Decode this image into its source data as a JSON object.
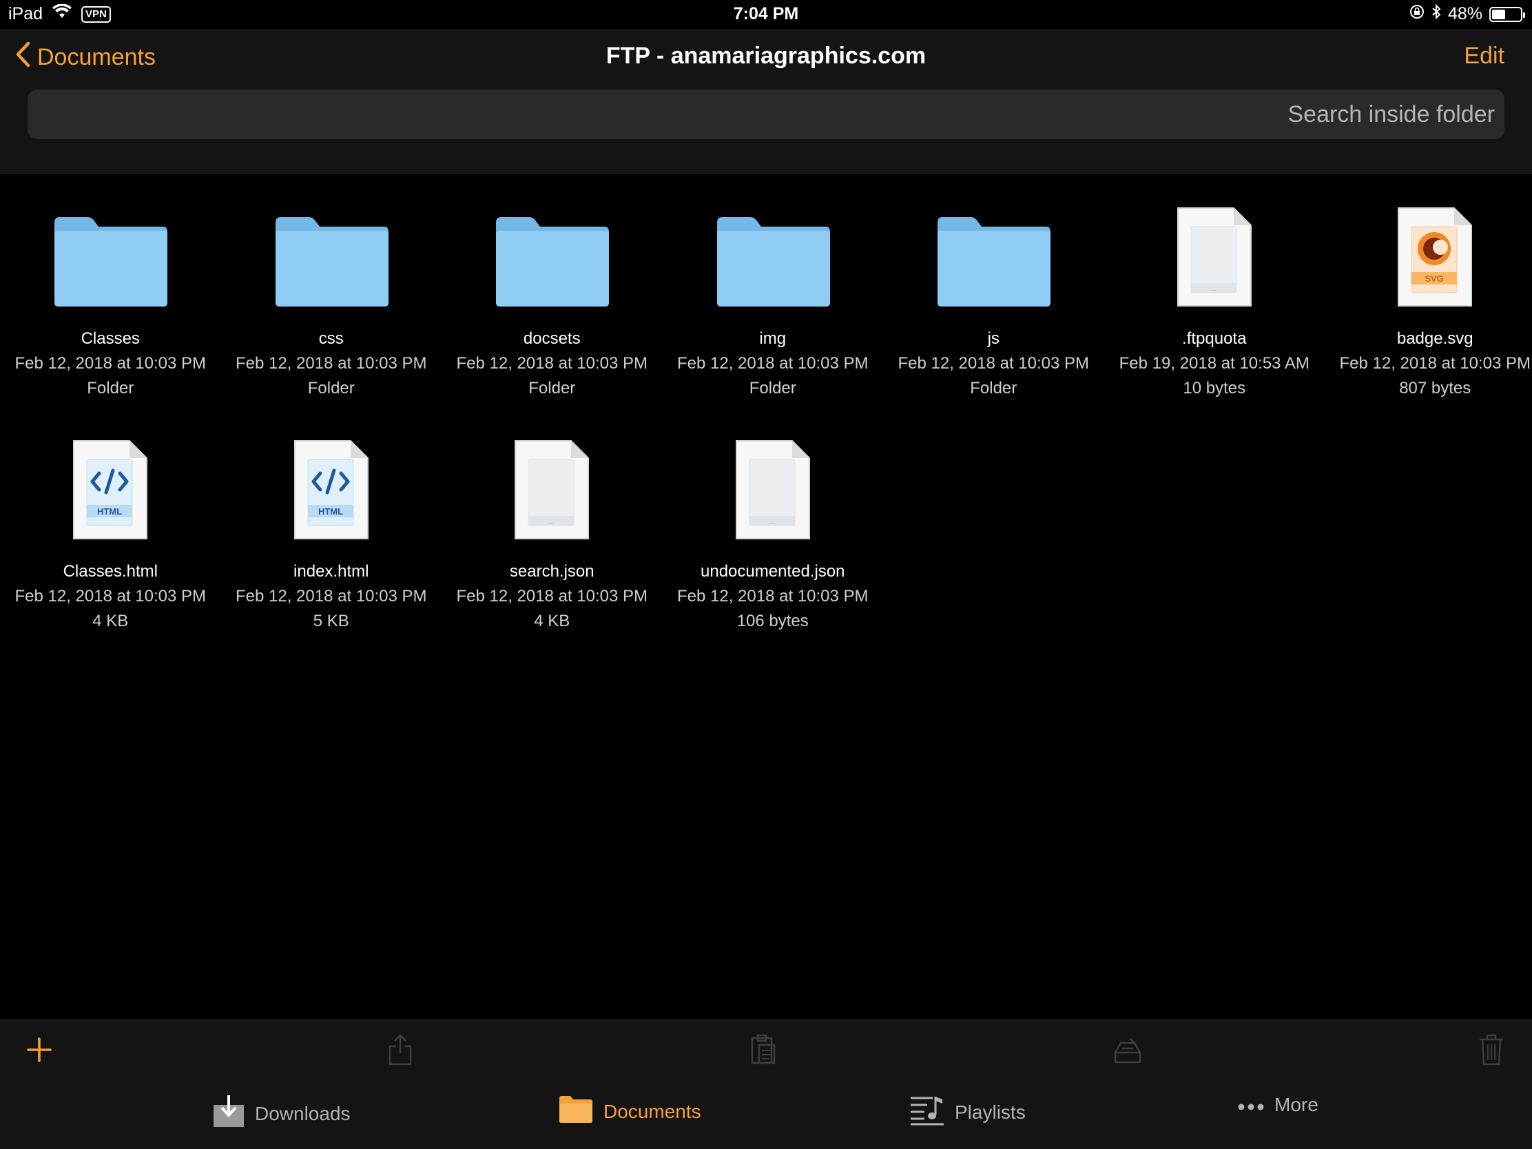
{
  "status_bar": {
    "device": "iPad",
    "vpn": "VPN",
    "time": "7:04 PM",
    "battery_percent": "48%",
    "battery_level": 0.48
  },
  "nav": {
    "back_label": "Documents",
    "title": "FTP - anamariagraphics.com",
    "edit_label": "Edit"
  },
  "search": {
    "placeholder": "Search inside folder"
  },
  "items": [
    {
      "name": "Classes",
      "date": "Feb 12, 2018 at 10:03 PM",
      "info": "Folder",
      "icon": "folder-icon"
    },
    {
      "name": "css",
      "date": "Feb 12, 2018 at 10:03 PM",
      "info": "Folder",
      "icon": "folder-icon"
    },
    {
      "name": "docsets",
      "date": "Feb 12, 2018 at 10:03 PM",
      "info": "Folder",
      "icon": "folder-icon"
    },
    {
      "name": "img",
      "date": "Feb 12, 2018 at 10:03 PM",
      "info": "Folder",
      "icon": "folder-icon"
    },
    {
      "name": "js",
      "date": "Feb 12, 2018 at 10:03 PM",
      "info": "Folder",
      "icon": "folder-icon"
    },
    {
      "name": ".ftpquota",
      "date": "Feb 19, 2018 at 10:53 AM",
      "info": "10 bytes",
      "icon": "generic-file-icon"
    },
    {
      "name": "badge.svg",
      "date": "Feb 12, 2018 at 10:03 PM",
      "info": "807 bytes",
      "icon": "svg-file-icon",
      "badge": "SVG"
    },
    {
      "name": "Classes.html",
      "date": "Feb 12, 2018 at 10:03 PM",
      "info": "4 KB",
      "icon": "html-file-icon",
      "badge": "HTML"
    },
    {
      "name": "index.html",
      "date": "Feb 12, 2018 at 10:03 PM",
      "info": "5 KB",
      "icon": "html-file-icon",
      "badge": "HTML"
    },
    {
      "name": "search.json",
      "date": "Feb 12, 2018 at 10:03 PM",
      "info": "4 KB",
      "icon": "generic-file-icon"
    },
    {
      "name": "undocumented.json",
      "date": "Feb 12, 2018 at 10:03 PM",
      "info": "106 bytes",
      "icon": "generic-file-icon"
    }
  ],
  "toolbar": [
    {
      "icon": "plus-icon"
    },
    {
      "icon": "share-icon"
    },
    {
      "icon": "clipboard-icon"
    },
    {
      "icon": "archive-icon"
    },
    {
      "icon": "trash-icon"
    }
  ],
  "tabs": [
    {
      "label": "Downloads",
      "icon": "download-icon",
      "active": false
    },
    {
      "label": "Documents",
      "icon": "folder-icon",
      "active": true
    },
    {
      "label": "Playlists",
      "icon": "playlist-icon",
      "active": false
    },
    {
      "label": "More",
      "icon": "more-icon",
      "active": false
    }
  ],
  "colors": {
    "accent": "#f5a03a",
    "folder": "#8fcdf4",
    "background": "#000000",
    "bar": "#141414"
  }
}
